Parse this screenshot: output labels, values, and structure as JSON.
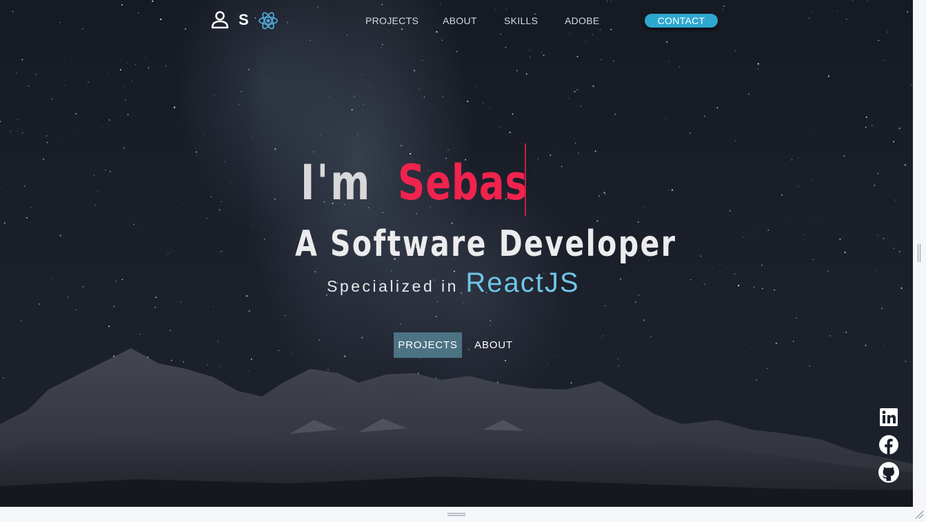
{
  "nav": {
    "brand_letter": "S",
    "links": [
      {
        "label": "PROJECTS"
      },
      {
        "label": "ABOUT"
      },
      {
        "label": "SKILLS"
      },
      {
        "label": "ADOBE"
      }
    ],
    "contact_label": "CONTACT"
  },
  "hero": {
    "intro": "I'm",
    "name": "Sebas",
    "title": "A Software Developer",
    "specialized": "Specialized in",
    "tech": "ReactJS",
    "buttons": {
      "projects_label": "PROJECTS",
      "about_label": "ABOUT"
    }
  },
  "social": {
    "icons": [
      "linkedin-icon",
      "facebook-icon",
      "github-icon"
    ]
  },
  "colors": {
    "accent_name": "#f0234e",
    "accent_tech": "#6ec6e8",
    "contact_button": "#2ea7cf",
    "projects_button": "#4c7384"
  }
}
